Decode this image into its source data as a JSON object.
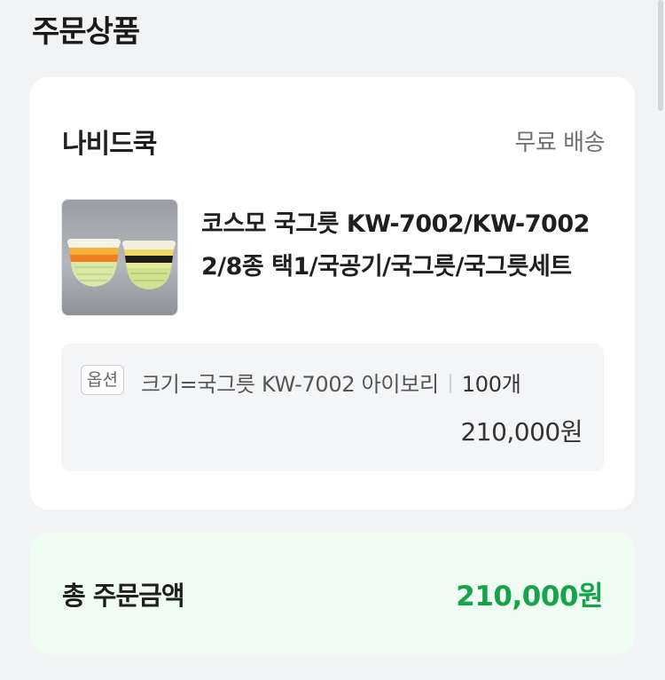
{
  "section": {
    "title": "주문상품"
  },
  "order": {
    "seller_name": "나비드쿡",
    "shipping_label": "무료 배송",
    "product": {
      "thumbnail_icon": "product-image",
      "name": "코스모 국그릇 KW-7002/KW-70022/8종 택1/국공기/국그릇/국그릇세트"
    },
    "option": {
      "badge": "옵션",
      "text": "크기=국그릇 KW-7002 아이보리",
      "quantity": "100개",
      "price": "210,000원"
    }
  },
  "total": {
    "label": "총 주문금액",
    "value": "210,000원"
  },
  "colors": {
    "accent_green": "#16a34a",
    "total_bg": "#eefcf2",
    "page_bg": "#f2f3f5"
  }
}
